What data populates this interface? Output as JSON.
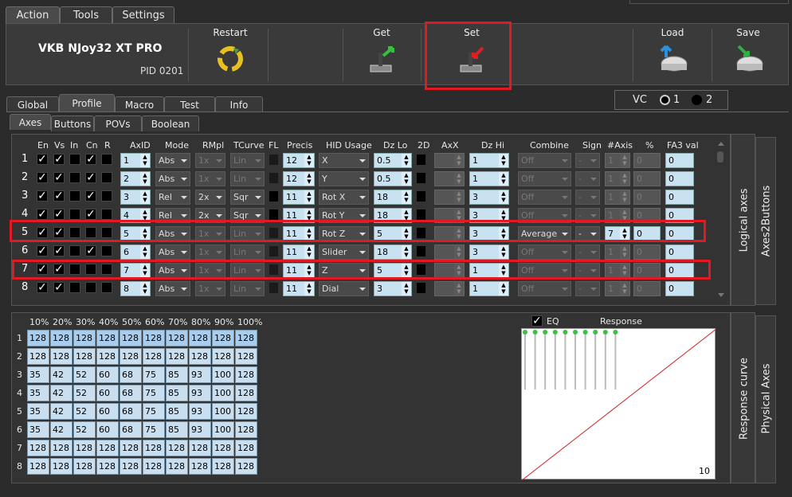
{
  "tabs": [
    "Action",
    "Tools",
    "Settings"
  ],
  "device": {
    "name": "VKB NJoy32 XT PRO",
    "pid": "PID 0201"
  },
  "toolbar": {
    "restart": "Restart",
    "get": "Get",
    "set": "Set",
    "load": "Load",
    "save": "Save"
  },
  "subtabs": [
    "Global",
    "Profile",
    "Macro",
    "Test",
    "Info"
  ],
  "vc": {
    "label": "VC",
    "opt1": "1",
    "opt2": "2"
  },
  "subsubtabs": [
    "Axes",
    "Buttons",
    "POVs",
    "Boolean"
  ],
  "headers": {
    "en": "En",
    "vs": "Vs",
    "in": "In",
    "cn": "Cn",
    "r": "R",
    "axid": "AxID",
    "mode": "Mode",
    "rmpl": "RMpl",
    "tcurve": "TCurve",
    "fl": "FL",
    "precis": "Precis",
    "hid": "HID Usage",
    "dzlo": "Dz Lo",
    "d2": "2D",
    "axx": "AxX",
    "dzhi": "Dz Hi",
    "combine": "Combine",
    "sign": "Sign",
    "naxis": "#Axis",
    "pct": "%",
    "fa3": "FA3 val"
  },
  "rows": [
    {
      "n": "1",
      "en": "✓",
      "vs": "✓",
      "cn": "✓",
      "axid": "1",
      "mode": "Abs",
      "rmpl": "1x",
      "tc": "Lin",
      "precis": "12",
      "hid": "X",
      "dzlo": "0.5",
      "dzhi": "1",
      "combine": "Off",
      "sign": "-",
      "naxis": "1",
      "pct": "0",
      "fa3": "0"
    },
    {
      "n": "2",
      "en": "✓",
      "vs": "✓",
      "cn": "✓",
      "axid": "2",
      "mode": "Abs",
      "rmpl": "1x",
      "tc": "Lin",
      "precis": "12",
      "hid": "Y",
      "dzlo": "0.5",
      "dzhi": "1",
      "combine": "Off",
      "sign": "-",
      "naxis": "1",
      "pct": "0",
      "fa3": "0"
    },
    {
      "n": "3",
      "en": "✓",
      "vs": "✓",
      "cn": "✓",
      "axid": "3",
      "mode": "Rel",
      "rmpl": "2x",
      "tc": "Sqr",
      "precis": "11",
      "hid": "Rot X",
      "dzlo": "18",
      "dzhi": "3",
      "combine": "Off",
      "sign": "-",
      "naxis": "1",
      "pct": "0",
      "fa3": "0"
    },
    {
      "n": "4",
      "en": "✓",
      "vs": "✓",
      "cn": "✓",
      "axid": "4",
      "mode": "Rel",
      "rmpl": "2x",
      "tc": "Sqr",
      "precis": "11",
      "hid": "Rot Y",
      "dzlo": "18",
      "dzhi": "3",
      "combine": "Off",
      "sign": "-",
      "naxis": "1",
      "pct": "0",
      "fa3": "0"
    },
    {
      "n": "5",
      "en": "✓",
      "vs": "✓",
      "cn": "",
      "axid": "5",
      "mode": "Abs",
      "rmpl": "1x",
      "tc": "Lin",
      "precis": "11",
      "hid": "Rot Z",
      "dzlo": "5",
      "dzhi": "3",
      "combine": "Average",
      "sign": "-",
      "naxis": "7",
      "pct": "0",
      "fa3": "0"
    },
    {
      "n": "6",
      "en": "✓",
      "vs": "✓",
      "cn": "✓",
      "axid": "6",
      "mode": "Abs",
      "rmpl": "1x",
      "tc": "Lin",
      "precis": "11",
      "hid": "Slider",
      "dzlo": "18",
      "dzhi": "3",
      "combine": "Off",
      "sign": "-",
      "naxis": "1",
      "pct": "0",
      "fa3": "0"
    },
    {
      "n": "7",
      "en": "✓",
      "vs": "✓",
      "cn": "",
      "axid": "7",
      "mode": "Abs",
      "rmpl": "1x",
      "tc": "Lin",
      "precis": "11",
      "hid": "Z",
      "dzlo": "5",
      "dzhi": "1",
      "combine": "Off",
      "sign": "-",
      "naxis": "1",
      "pct": "0",
      "fa3": "0"
    },
    {
      "n": "8",
      "en": "✓",
      "vs": "✓",
      "cn": "",
      "axid": "8",
      "mode": "Abs",
      "rmpl": "1x",
      "tc": "Lin",
      "precis": "11",
      "hid": "Dial",
      "dzlo": "3",
      "dzhi": "1",
      "combine": "Off",
      "sign": "-",
      "naxis": "1",
      "pct": "0",
      "fa3": "0"
    }
  ],
  "side": {
    "logical": "Logical axes",
    "axes2buttons": "Axes2Buttons",
    "response": "Response curve",
    "physical": "Physical Axes"
  },
  "curve": {
    "cols": [
      "10%",
      "20%",
      "30%",
      "40%",
      "50%",
      "60%",
      "70%",
      "80%",
      "90%",
      "100%"
    ],
    "rows": [
      {
        "n": "1",
        "v": [
          "128",
          "128",
          "128",
          "128",
          "128",
          "128",
          "128",
          "128",
          "128",
          "128"
        ]
      },
      {
        "n": "2",
        "v": [
          "128",
          "128",
          "128",
          "128",
          "128",
          "128",
          "128",
          "128",
          "128",
          "128"
        ]
      },
      {
        "n": "3",
        "v": [
          "35",
          "42",
          "52",
          "60",
          "68",
          "75",
          "85",
          "93",
          "100",
          "128"
        ]
      },
      {
        "n": "4",
        "v": [
          "35",
          "42",
          "52",
          "60",
          "68",
          "75",
          "85",
          "93",
          "100",
          "128"
        ]
      },
      {
        "n": "5",
        "v": [
          "35",
          "42",
          "52",
          "60",
          "68",
          "75",
          "85",
          "93",
          "100",
          "128"
        ]
      },
      {
        "n": "6",
        "v": [
          "35",
          "42",
          "52",
          "60",
          "68",
          "75",
          "85",
          "93",
          "100",
          "128"
        ]
      },
      {
        "n": "7",
        "v": [
          "128",
          "128",
          "128",
          "128",
          "128",
          "128",
          "128",
          "128",
          "128",
          "128"
        ]
      },
      {
        "n": "8",
        "v": [
          "128",
          "128",
          "128",
          "128",
          "128",
          "128",
          "128",
          "128",
          "128",
          "128"
        ]
      }
    ],
    "eq": "EQ",
    "eq_check": "✓",
    "response": "Response",
    "value": "10"
  },
  "colors": {
    "highlight": "#e01a22",
    "cell": "#c9e2f2"
  }
}
